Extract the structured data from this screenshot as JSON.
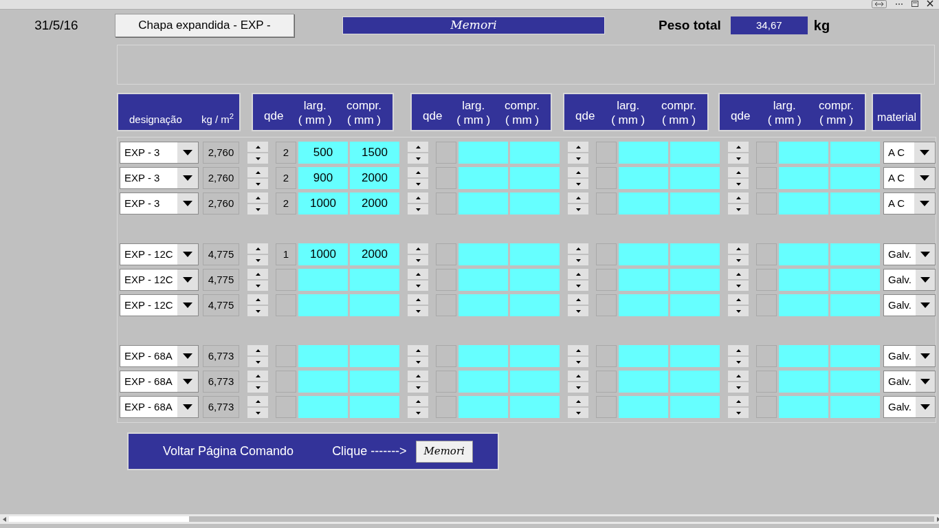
{
  "date": "31/5/16",
  "title_button": "Chapa expandida - EXP -",
  "memori_banner": "Memori",
  "total": {
    "label": "Peso total",
    "value": "34,67",
    "unit": "kg"
  },
  "header": {
    "designacao": "designação",
    "kg_m2": "kg / m$^{2}$",
    "groups": [
      {
        "qde": "qde",
        "larg": [
          "larg.",
          "( mm )"
        ],
        "compr": [
          "compr.",
          "( mm )"
        ]
      },
      {
        "qde": "qde",
        "larg": [
          "larg.",
          "( mm )"
        ],
        "compr": [
          "compr.",
          "( mm )"
        ]
      },
      {
        "qde": "qde",
        "larg": [
          "larg.",
          "( mm )"
        ],
        "compr": [
          "compr.",
          "( mm )"
        ]
      },
      {
        "qde": "qde",
        "larg": [
          "larg.",
          "( mm )"
        ],
        "compr": [
          "compr.",
          "( mm )"
        ]
      }
    ],
    "material": "material"
  },
  "sections": [
    {
      "rows": [
        {
          "designacao": "EXP - 3",
          "kg_m2": "2,760",
          "material": "A C",
          "groups": [
            {
              "qde": "2",
              "larg": "500",
              "compr": "1500"
            }
          ]
        },
        {
          "designacao": "EXP - 3",
          "kg_m2": "2,760",
          "material": "A C",
          "groups": [
            {
              "qde": "2",
              "larg": "900",
              "compr": "2000"
            }
          ]
        },
        {
          "designacao": "EXP - 3",
          "kg_m2": "2,760",
          "material": "A C",
          "groups": [
            {
              "qde": "2",
              "larg": "1000",
              "compr": "2000"
            }
          ]
        }
      ]
    },
    {
      "rows": [
        {
          "designacao": "EXP - 12C",
          "kg_m2": "4,775",
          "material": "Galv.",
          "groups": [
            {
              "qde": "1",
              "larg": "1000",
              "compr": "2000"
            }
          ]
        },
        {
          "designacao": "EXP - 12C",
          "kg_m2": "4,775",
          "material": "Galv."
        },
        {
          "designacao": "EXP - 12C",
          "kg_m2": "4,775",
          "material": "Galv."
        }
      ]
    },
    {
      "rows": [
        {
          "designacao": "EXP - 68A",
          "kg_m2": "6,773",
          "material": "Galv."
        },
        {
          "designacao": "EXP - 68A",
          "kg_m2": "6,773",
          "material": "Galv."
        },
        {
          "designacao": "EXP - 68A",
          "kg_m2": "6,773",
          "material": "Galv."
        }
      ]
    }
  ],
  "footer": {
    "back": "Voltar Página Comando",
    "prompt": "Clique ------->",
    "button": "Memori"
  }
}
